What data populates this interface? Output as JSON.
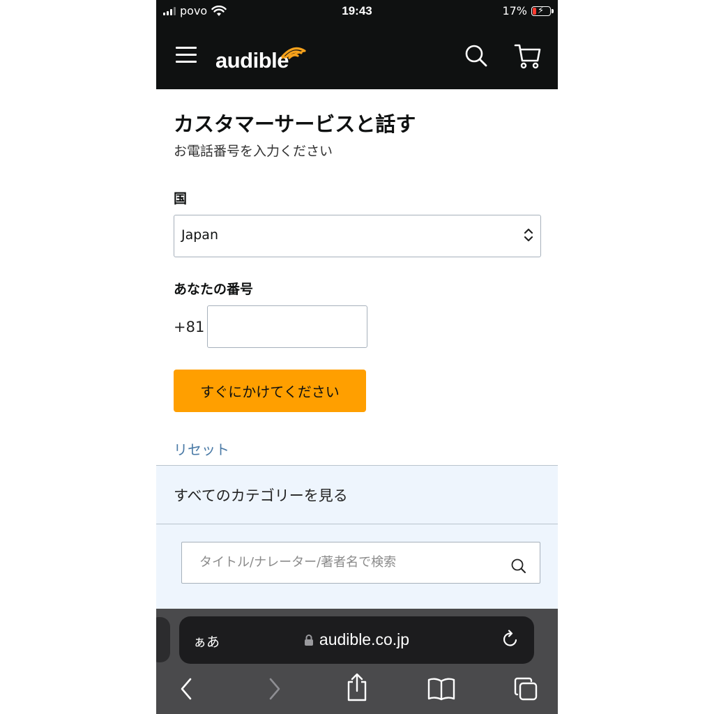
{
  "status_bar": {
    "carrier": "povo",
    "time": "19:43",
    "battery_percent": "17%",
    "battery_color": "#ff3b30"
  },
  "header": {
    "logo": "audible",
    "icons": [
      "menu-icon",
      "search-icon",
      "cart-icon"
    ],
    "background": "#0f1111",
    "accent": "#f7a21c"
  },
  "form": {
    "title": "カスタマーサービスと話す",
    "subtitle": "お電話番号を入力ください",
    "country_label": "国",
    "country_value": "Japan",
    "number_label": "あなたの番号",
    "country_code": "+81",
    "phone_value": "",
    "call_button": "すぐにかけてください",
    "call_button_color": "#ff9f00",
    "reset_link": "リセット"
  },
  "categories": {
    "label": "すべてのカテゴリーを見る"
  },
  "search": {
    "placeholder": "タイトル/ナレーター/著者名で検索"
  },
  "browser": {
    "aa_label": "ぁあ",
    "url": "audible.co.jp",
    "toolbar_icons": [
      "back-icon",
      "forward-icon",
      "share-icon",
      "bookmarks-icon",
      "tabs-icon"
    ]
  }
}
